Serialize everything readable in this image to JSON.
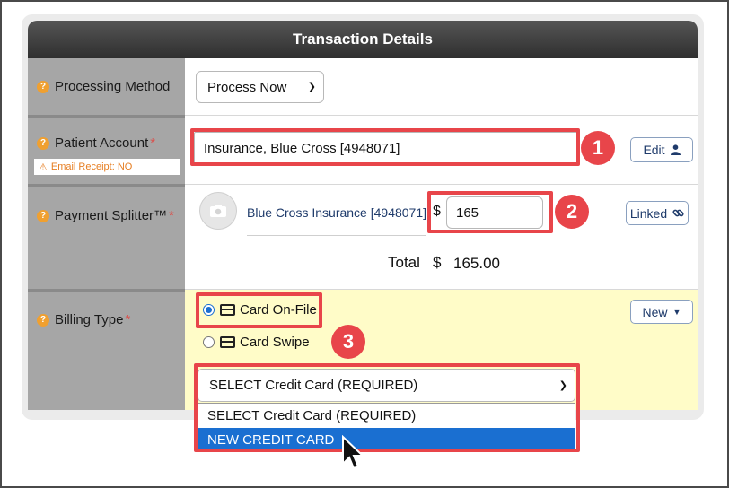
{
  "header": {
    "title": "Transaction Details"
  },
  "processing_method": {
    "label": "Processing Method",
    "selected": "Process Now"
  },
  "patient_account": {
    "label": "Patient Account",
    "required_mark": "*",
    "email_receipt": "Email Receipt: NO",
    "value": "Insurance, Blue Cross [4948071]",
    "edit_label": "Edit"
  },
  "payment_splitter": {
    "label": "Payment Splitter™",
    "required_mark": "*",
    "account_link": "Blue Cross Insurance [4948071]",
    "currency": "$",
    "amount": "165",
    "linked_label": "Linked",
    "total_label": "Total",
    "total_currency": "$",
    "total_value": "165.00"
  },
  "billing_type": {
    "label": "Billing Type",
    "required_mark": "*",
    "options": [
      "Card On-File",
      "Card Swipe"
    ],
    "selected_option": "Card On-File",
    "new_label": "New",
    "card_select": {
      "selected": "SELECT Credit Card (REQUIRED)",
      "options": [
        "SELECT Credit Card (REQUIRED)",
        "NEW CREDIT CARD"
      ],
      "highlighted": "NEW CREDIT CARD"
    }
  },
  "annotations": {
    "step1": "1",
    "step2": "2",
    "step3": "3"
  },
  "colors": {
    "accent_red": "#e8454a",
    "highlight_blue": "#1a6fd1",
    "label_gray": "#a6a6a6",
    "billing_yellow": "#fffcc8"
  },
  "icons": [
    "help-icon",
    "warning-icon",
    "user-icon",
    "camera-icon",
    "link-icon",
    "credit-card-icon",
    "caret-down-icon",
    "mouse-cursor-icon"
  ]
}
